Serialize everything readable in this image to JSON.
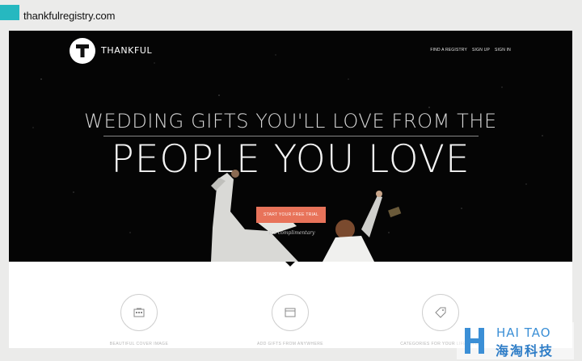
{
  "caption": {
    "site": "thankfulregistry.com"
  },
  "brand": {
    "name": "THANKFUL",
    "logo_letter": "T"
  },
  "nav": [
    {
      "label": "FIND A REGISTRY"
    },
    {
      "label": "SIGN UP"
    },
    {
      "label": "SIGN IN"
    }
  ],
  "hero": {
    "headline_top": "WEDDING GIFTS YOU'LL LOVE FROM THE",
    "headline_bottom": "PEOPLE YOU LOVE",
    "cta_label": "START YOUR FREE TRIAL",
    "cta_sub": "It's complimentary"
  },
  "features": [
    {
      "icon": "cover-image-icon",
      "label": "BEAUTIFUL COVER IMAGE"
    },
    {
      "icon": "gift-window-icon",
      "label": "ADD GIFTS FROM ANYWHERE"
    },
    {
      "icon": "tag-icon",
      "label": "CATEGORIES FOR YOUR LIFESTYLE"
    }
  ],
  "watermark": {
    "line1": "HAI TAO",
    "line2": "海淘科技"
  },
  "colors": {
    "accent": "#e8735a",
    "caption_swatch": "#26b8c0",
    "hero_bg": "#050505"
  }
}
